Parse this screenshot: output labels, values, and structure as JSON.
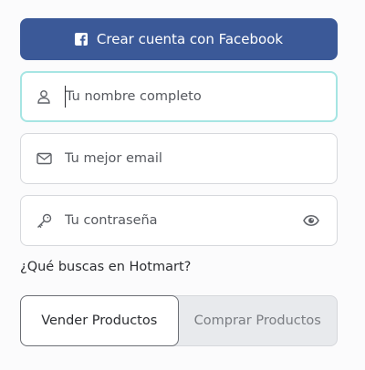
{
  "facebook_button": {
    "label": "Crear cuenta con Facebook",
    "color": "#3b5998"
  },
  "fields": {
    "name": {
      "placeholder": "Tu nombre completo",
      "value": "",
      "icon": "user-icon"
    },
    "email": {
      "placeholder": "Tu mejor email",
      "value": "",
      "icon": "envelope-icon"
    },
    "password": {
      "placeholder": "Tu contraseña",
      "value": "",
      "icon": "key-icon",
      "toggle_icon": "eye-icon"
    }
  },
  "question": "¿Qué buscas en Hotmart?",
  "options": {
    "sell": "Vender Productos",
    "buy": "Comprar Productos",
    "selected": "sell"
  },
  "colors": {
    "focus_border": "#a6e5e3",
    "field_border": "#d6d8dc",
    "text": "#2b2d31"
  }
}
